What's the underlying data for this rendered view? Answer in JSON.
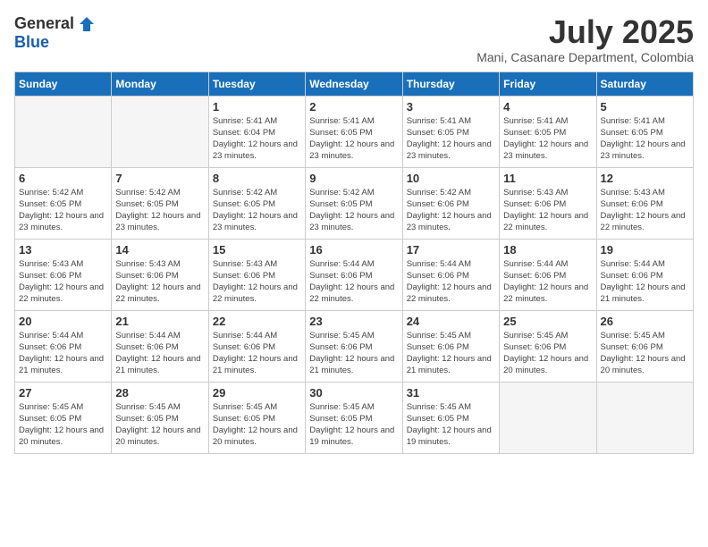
{
  "logo": {
    "general": "General",
    "blue": "Blue"
  },
  "header": {
    "month": "July 2025",
    "location": "Mani, Casanare Department, Colombia"
  },
  "days_of_week": [
    "Sunday",
    "Monday",
    "Tuesday",
    "Wednesday",
    "Thursday",
    "Friday",
    "Saturday"
  ],
  "weeks": [
    [
      {
        "day": "",
        "info": ""
      },
      {
        "day": "",
        "info": ""
      },
      {
        "day": "1",
        "sunrise": "Sunrise: 5:41 AM",
        "sunset": "Sunset: 6:04 PM",
        "daylight": "Daylight: 12 hours and 23 minutes."
      },
      {
        "day": "2",
        "sunrise": "Sunrise: 5:41 AM",
        "sunset": "Sunset: 6:05 PM",
        "daylight": "Daylight: 12 hours and 23 minutes."
      },
      {
        "day": "3",
        "sunrise": "Sunrise: 5:41 AM",
        "sunset": "Sunset: 6:05 PM",
        "daylight": "Daylight: 12 hours and 23 minutes."
      },
      {
        "day": "4",
        "sunrise": "Sunrise: 5:41 AM",
        "sunset": "Sunset: 6:05 PM",
        "daylight": "Daylight: 12 hours and 23 minutes."
      },
      {
        "day": "5",
        "sunrise": "Sunrise: 5:41 AM",
        "sunset": "Sunset: 6:05 PM",
        "daylight": "Daylight: 12 hours and 23 minutes."
      }
    ],
    [
      {
        "day": "6",
        "sunrise": "Sunrise: 5:42 AM",
        "sunset": "Sunset: 6:05 PM",
        "daylight": "Daylight: 12 hours and 23 minutes."
      },
      {
        "day": "7",
        "sunrise": "Sunrise: 5:42 AM",
        "sunset": "Sunset: 6:05 PM",
        "daylight": "Daylight: 12 hours and 23 minutes."
      },
      {
        "day": "8",
        "sunrise": "Sunrise: 5:42 AM",
        "sunset": "Sunset: 6:05 PM",
        "daylight": "Daylight: 12 hours and 23 minutes."
      },
      {
        "day": "9",
        "sunrise": "Sunrise: 5:42 AM",
        "sunset": "Sunset: 6:05 PM",
        "daylight": "Daylight: 12 hours and 23 minutes."
      },
      {
        "day": "10",
        "sunrise": "Sunrise: 5:42 AM",
        "sunset": "Sunset: 6:06 PM",
        "daylight": "Daylight: 12 hours and 23 minutes."
      },
      {
        "day": "11",
        "sunrise": "Sunrise: 5:43 AM",
        "sunset": "Sunset: 6:06 PM",
        "daylight": "Daylight: 12 hours and 22 minutes."
      },
      {
        "day": "12",
        "sunrise": "Sunrise: 5:43 AM",
        "sunset": "Sunset: 6:06 PM",
        "daylight": "Daylight: 12 hours and 22 minutes."
      }
    ],
    [
      {
        "day": "13",
        "sunrise": "Sunrise: 5:43 AM",
        "sunset": "Sunset: 6:06 PM",
        "daylight": "Daylight: 12 hours and 22 minutes."
      },
      {
        "day": "14",
        "sunrise": "Sunrise: 5:43 AM",
        "sunset": "Sunset: 6:06 PM",
        "daylight": "Daylight: 12 hours and 22 minutes."
      },
      {
        "day": "15",
        "sunrise": "Sunrise: 5:43 AM",
        "sunset": "Sunset: 6:06 PM",
        "daylight": "Daylight: 12 hours and 22 minutes."
      },
      {
        "day": "16",
        "sunrise": "Sunrise: 5:44 AM",
        "sunset": "Sunset: 6:06 PM",
        "daylight": "Daylight: 12 hours and 22 minutes."
      },
      {
        "day": "17",
        "sunrise": "Sunrise: 5:44 AM",
        "sunset": "Sunset: 6:06 PM",
        "daylight": "Daylight: 12 hours and 22 minutes."
      },
      {
        "day": "18",
        "sunrise": "Sunrise: 5:44 AM",
        "sunset": "Sunset: 6:06 PM",
        "daylight": "Daylight: 12 hours and 22 minutes."
      },
      {
        "day": "19",
        "sunrise": "Sunrise: 5:44 AM",
        "sunset": "Sunset: 6:06 PM",
        "daylight": "Daylight: 12 hours and 21 minutes."
      }
    ],
    [
      {
        "day": "20",
        "sunrise": "Sunrise: 5:44 AM",
        "sunset": "Sunset: 6:06 PM",
        "daylight": "Daylight: 12 hours and 21 minutes."
      },
      {
        "day": "21",
        "sunrise": "Sunrise: 5:44 AM",
        "sunset": "Sunset: 6:06 PM",
        "daylight": "Daylight: 12 hours and 21 minutes."
      },
      {
        "day": "22",
        "sunrise": "Sunrise: 5:44 AM",
        "sunset": "Sunset: 6:06 PM",
        "daylight": "Daylight: 12 hours and 21 minutes."
      },
      {
        "day": "23",
        "sunrise": "Sunrise: 5:45 AM",
        "sunset": "Sunset: 6:06 PM",
        "daylight": "Daylight: 12 hours and 21 minutes."
      },
      {
        "day": "24",
        "sunrise": "Sunrise: 5:45 AM",
        "sunset": "Sunset: 6:06 PM",
        "daylight": "Daylight: 12 hours and 21 minutes."
      },
      {
        "day": "25",
        "sunrise": "Sunrise: 5:45 AM",
        "sunset": "Sunset: 6:06 PM",
        "daylight": "Daylight: 12 hours and 20 minutes."
      },
      {
        "day": "26",
        "sunrise": "Sunrise: 5:45 AM",
        "sunset": "Sunset: 6:06 PM",
        "daylight": "Daylight: 12 hours and 20 minutes."
      }
    ],
    [
      {
        "day": "27",
        "sunrise": "Sunrise: 5:45 AM",
        "sunset": "Sunset: 6:05 PM",
        "daylight": "Daylight: 12 hours and 20 minutes."
      },
      {
        "day": "28",
        "sunrise": "Sunrise: 5:45 AM",
        "sunset": "Sunset: 6:05 PM",
        "daylight": "Daylight: 12 hours and 20 minutes."
      },
      {
        "day": "29",
        "sunrise": "Sunrise: 5:45 AM",
        "sunset": "Sunset: 6:05 PM",
        "daylight": "Daylight: 12 hours and 20 minutes."
      },
      {
        "day": "30",
        "sunrise": "Sunrise: 5:45 AM",
        "sunset": "Sunset: 6:05 PM",
        "daylight": "Daylight: 12 hours and 19 minutes."
      },
      {
        "day": "31",
        "sunrise": "Sunrise: 5:45 AM",
        "sunset": "Sunset: 6:05 PM",
        "daylight": "Daylight: 12 hours and 19 minutes."
      },
      {
        "day": "",
        "info": ""
      },
      {
        "day": "",
        "info": ""
      }
    ]
  ]
}
